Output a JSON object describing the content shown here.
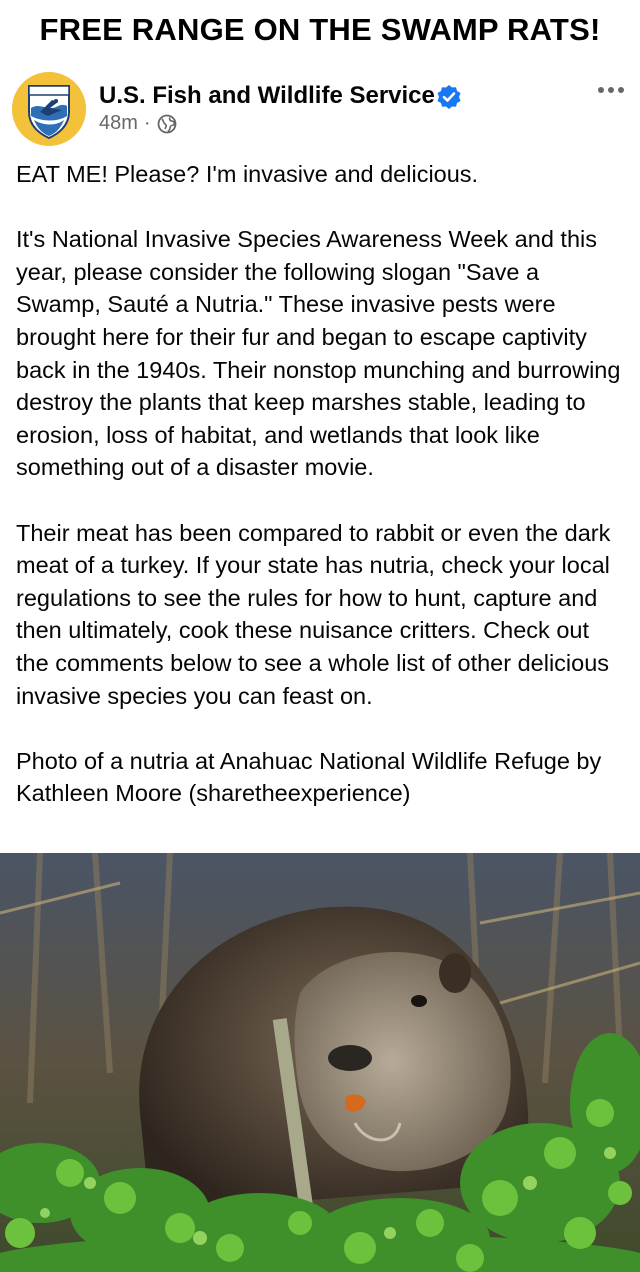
{
  "headline": "FREE RANGE ON THE SWAMP RATS!",
  "post": {
    "author": "U.S. Fish and Wildlife Service",
    "verified": true,
    "time": "48m",
    "separator": "·",
    "audience_icon": "globe-icon",
    "more_icon": "more-horizontal-icon",
    "avatar_logo_text": "U.S. FISH & WILDLIFE SERVICE",
    "paragraphs": [
      "EAT ME! Please? I'm invasive and delicious.",
      "It's National Invasive Species Awareness Week and this year, please consider the following slogan \"Save a Swamp, Sauté a Nutria.\" These invasive pests were brought here for their fur and began to escape captivity back in the 1940s. Their nonstop munching and burrowing destroy the plants that keep marshes stable, leading to erosion, loss of habitat, and wetlands that look like something out of a disaster movie.",
      "Their meat has been compared to rabbit or even the dark meat of a turkey. If your state has nutria, check your local regulations to see the rules for how to hunt, capture and then ultimately, cook these nuisance critters. Check out the comments below to see a whole list of other delicious invasive species you can feast on.",
      "Photo of a nutria at Anahuac National Wildlife Refuge by Kathleen Moore (sharetheexperience)"
    ]
  },
  "colors": {
    "verified_blue": "#1877f2",
    "meta_gray": "#65676b",
    "logo_gold": "#f4c23a",
    "logo_blue": "#2f6fb5"
  }
}
